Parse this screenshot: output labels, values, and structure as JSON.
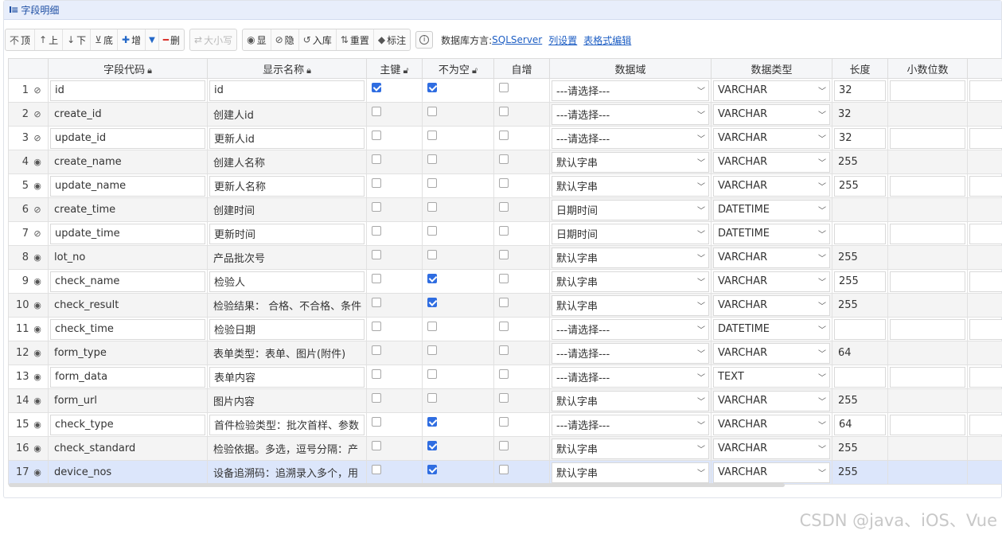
{
  "panel": {
    "title": "字段明细",
    "icon": "table-fields-icon"
  },
  "toolbar": {
    "move_buttons": [
      {
        "name": "move-top-button",
        "icon": "move-top-icon",
        "glyph": "⊤",
        "label": "顶"
      },
      {
        "name": "move-up-button",
        "icon": "arrow-up-icon",
        "glyph": "↑",
        "label": "上"
      },
      {
        "name": "move-down-button",
        "icon": "arrow-down-icon",
        "glyph": "↓",
        "label": "下"
      },
      {
        "name": "move-bottom-button",
        "icon": "move-bottom-icon",
        "glyph": "⊥",
        "label": "底"
      }
    ],
    "add_label": "增",
    "delete_label": "删",
    "case_label": "大小写",
    "show_label": "显",
    "hide_label": "隐",
    "import_label": "入库",
    "reset_label": "重置",
    "mark_label": "标注",
    "dialect_label": "数据库方言:",
    "dialect_value": "SQLServer",
    "column_settings_link": "列设置",
    "table_edit_link": "表格式编辑"
  },
  "columns": [
    "字段代码",
    "显示名称",
    "主键",
    "不为空",
    "自增",
    "数据域",
    "数据类型",
    "长度",
    "小数位数"
  ],
  "rows": [
    {
      "no": "1",
      "visible": false,
      "code": "id",
      "name": "id",
      "pk": true,
      "notnull": true,
      "auto": false,
      "domain": "---请选择---",
      "type": "VARCHAR",
      "length": "32",
      "scale": "",
      "editable": true
    },
    {
      "no": "2",
      "visible": false,
      "code": "create_id",
      "name": "创建人id",
      "pk": false,
      "notnull": false,
      "auto": false,
      "domain": "---请选择---",
      "type": "VARCHAR",
      "length": "32",
      "scale": "",
      "editable": false
    },
    {
      "no": "3",
      "visible": false,
      "code": "update_id",
      "name": "更新人id",
      "pk": false,
      "notnull": false,
      "auto": false,
      "domain": "---请选择---",
      "type": "VARCHAR",
      "length": "32",
      "scale": "",
      "editable": true
    },
    {
      "no": "4",
      "visible": true,
      "code": "create_name",
      "name": "创建人名称",
      "pk": false,
      "notnull": false,
      "auto": false,
      "domain": "默认字串",
      "type": "VARCHAR",
      "length": "255",
      "scale": "",
      "editable": false
    },
    {
      "no": "5",
      "visible": true,
      "code": "update_name",
      "name": "更新人名称",
      "pk": false,
      "notnull": false,
      "auto": false,
      "domain": "默认字串",
      "type": "VARCHAR",
      "length": "255",
      "scale": "",
      "editable": true
    },
    {
      "no": "6",
      "visible": false,
      "code": "create_time",
      "name": "创建时间",
      "pk": false,
      "notnull": false,
      "auto": false,
      "domain": "日期时间",
      "type": "DATETIME",
      "length": "",
      "scale": "",
      "editable": false
    },
    {
      "no": "7",
      "visible": false,
      "code": "update_time",
      "name": "更新时间",
      "pk": false,
      "notnull": false,
      "auto": false,
      "domain": "日期时间",
      "type": "DATETIME",
      "length": "",
      "scale": "",
      "editable": true
    },
    {
      "no": "8",
      "visible": true,
      "code": "lot_no",
      "name": "产品批次号",
      "pk": false,
      "notnull": false,
      "auto": false,
      "domain": "默认字串",
      "type": "VARCHAR",
      "length": "255",
      "scale": "",
      "editable": false
    },
    {
      "no": "9",
      "visible": true,
      "code": "check_name",
      "name": "检验人",
      "pk": false,
      "notnull": true,
      "auto": false,
      "domain": "默认字串",
      "type": "VARCHAR",
      "length": "255",
      "scale": "",
      "editable": true
    },
    {
      "no": "10",
      "visible": true,
      "code": "check_result",
      "name": "检验结果： 合格、不合格、条件",
      "pk": false,
      "notnull": true,
      "auto": false,
      "domain": "默认字串",
      "type": "VARCHAR",
      "length": "255",
      "scale": "",
      "editable": false
    },
    {
      "no": "11",
      "visible": true,
      "code": "check_time",
      "name": "检验日期",
      "pk": false,
      "notnull": false,
      "auto": false,
      "domain": "---请选择---",
      "type": "DATETIME",
      "length": "",
      "scale": "",
      "editable": true
    },
    {
      "no": "12",
      "visible": true,
      "code": "form_type",
      "name": "表单类型：表单、图片(附件)",
      "pk": false,
      "notnull": false,
      "auto": false,
      "domain": "---请选择---",
      "type": "VARCHAR",
      "length": "64",
      "scale": "",
      "editable": false
    },
    {
      "no": "13",
      "visible": true,
      "code": "form_data",
      "name": "表单内容",
      "pk": false,
      "notnull": false,
      "auto": false,
      "domain": "---请选择---",
      "type": "TEXT",
      "length": "",
      "scale": "",
      "editable": true
    },
    {
      "no": "14",
      "visible": true,
      "code": "form_url",
      "name": "图片内容",
      "pk": false,
      "notnull": false,
      "auto": false,
      "domain": "默认字串",
      "type": "VARCHAR",
      "length": "255",
      "scale": "",
      "editable": false
    },
    {
      "no": "15",
      "visible": true,
      "code": "check_type",
      "name": "首件检验类型：批次首样、参数",
      "pk": false,
      "notnull": true,
      "auto": false,
      "domain": "---请选择---",
      "type": "VARCHAR",
      "length": "64",
      "scale": "",
      "editable": true
    },
    {
      "no": "16",
      "visible": true,
      "code": "check_standard",
      "name": "检验依据。多选，逗号分隔：产",
      "pk": false,
      "notnull": true,
      "auto": false,
      "domain": "默认字串",
      "type": "VARCHAR",
      "length": "255",
      "scale": "",
      "editable": false
    },
    {
      "no": "17",
      "visible": true,
      "code": "device_nos",
      "name": "设备追溯码：追溯录入多个，用",
      "pk": false,
      "notnull": true,
      "auto": false,
      "domain": "默认字串",
      "type": "VARCHAR",
      "length": "255",
      "scale": "",
      "editable": false,
      "selected": true
    }
  ],
  "watermark": "CSDN @java、iOS、Vue",
  "colors": {
    "accent": "#2f6de1",
    "header_bg": "#e8eefb",
    "selected_row": "#dce6fb",
    "link": "#1f5fc4"
  }
}
